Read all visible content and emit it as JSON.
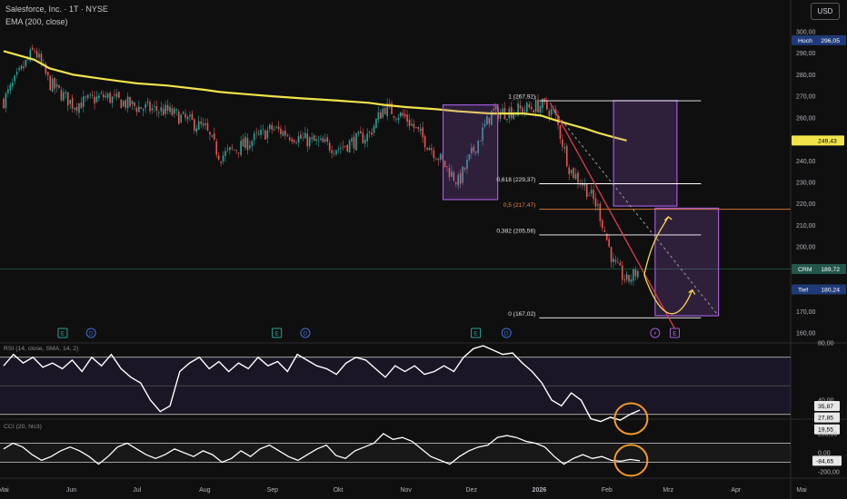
{
  "header": {
    "symbol_line": "Salesforce, Inc. · 1T · NYSE",
    "ema_line": "EMA (200, close)",
    "currency_button": "USD"
  },
  "colors": {
    "up": "#26a69a",
    "down": "#ef5350",
    "ema": "#f2e34b",
    "box": "#a15ad8",
    "fib": "#ffffff",
    "fib_mid": "#e8833a",
    "trend_red": "#e03a4c",
    "sketch": "#f5d84a",
    "ring": "#f39c22"
  },
  "chart_data": [
    {
      "type": "candlestick",
      "ylim": [
        155,
        302
      ],
      "y_ticks": [
        "300,00",
        "290,00",
        "280,00",
        "270,00",
        "260,00",
        "250,00",
        "240,00",
        "230,00",
        "220,00",
        "210,00",
        "200,00",
        "190,00",
        "170,00",
        "160,00"
      ],
      "x_ticks": [
        "Mai",
        "Jun",
        "Jul",
        "Aug",
        "Sep",
        "Okt",
        "Nov",
        "Dez",
        "2026",
        "Feb",
        "Mrz",
        "Apr",
        "Mai"
      ],
      "x": [
        "2025-05-01",
        "2025-05-15",
        "2025-05-22",
        "2025-06-02",
        "2025-06-16",
        "2025-07-01",
        "2025-07-15",
        "2025-08-01",
        "2025-08-08",
        "2025-08-20",
        "2025-09-01",
        "2025-09-15",
        "2025-10-01",
        "2025-10-15",
        "2025-10-22",
        "2025-11-01",
        "2025-11-15",
        "2025-11-25",
        "2025-12-10",
        "2025-12-25",
        "2026-01-02",
        "2026-01-08",
        "2026-01-15",
        "2026-01-22",
        "2026-01-28",
        "2026-02-04",
        "2026-02-10",
        "2026-02-16"
      ],
      "close": [
        268,
        292,
        276,
        266,
        270,
        265,
        263,
        255,
        242,
        248,
        255,
        250,
        246,
        252,
        265,
        260,
        243,
        230,
        262,
        264,
        266,
        262,
        236,
        228,
        218,
        192,
        184,
        189.72
      ],
      "ema_200": [
        291,
        287,
        283,
        280,
        278,
        276,
        275,
        273,
        272,
        271,
        270,
        269,
        268,
        267,
        266,
        265,
        264,
        263,
        262,
        262,
        261,
        259,
        257,
        255,
        253,
        251,
        249.43
      ],
      "price_labels": [
        {
          "label": "Hoch",
          "value": "296,05",
          "v": 296.05
        },
        {
          "label": "",
          "value": "249,43",
          "v": 249.43
        },
        {
          "label": "CRM",
          "value": "189,72",
          "v": 189.72
        },
        {
          "label": "Tief",
          "value": "180,24",
          "v": 180.24
        }
      ],
      "fib_levels": [
        {
          "label": "1 (267,92)",
          "v": 267.92
        },
        {
          "label": "0,618 (229,37)",
          "v": 229.37
        },
        {
          "label": "0,5 (217,47)",
          "v": 217.47
        },
        {
          "label": "0,382 (205,56)",
          "v": 205.56
        },
        {
          "label": "0 (167,02)",
          "v": 167.02
        }
      ],
      "event_markers": [
        {
          "x": "2025-05-28",
          "text": "E"
        },
        {
          "x": "2025-06-10",
          "text": "D"
        },
        {
          "x": "2025-09-03",
          "text": "E"
        },
        {
          "x": "2025-09-16",
          "text": "D"
        },
        {
          "x": "2025-12-03",
          "text": "E"
        },
        {
          "x": "2025-12-17",
          "text": "D"
        },
        {
          "x": "2026-02-23",
          "text": "⚡"
        },
        {
          "x": "2026-03-04",
          "text": "E"
        }
      ]
    },
    {
      "type": "line",
      "title": "RSI (14, close, SMA, 14, 2)",
      "ylim": [
        15,
        85
      ],
      "y_ticks": [
        "80,00",
        "40,00"
      ],
      "bands": [
        70,
        50,
        30
      ],
      "values": [
        64,
        72,
        66,
        70,
        63,
        66,
        62,
        68,
        60,
        70,
        64,
        72,
        62,
        56,
        52,
        40,
        32,
        36,
        60,
        66,
        70,
        62,
        67,
        60,
        66,
        62,
        70,
        64,
        67,
        60,
        72,
        68,
        64,
        62,
        58,
        66,
        70,
        68,
        62,
        56,
        64,
        60,
        64,
        58,
        60,
        64,
        60,
        70,
        76,
        78,
        75,
        72,
        73,
        66,
        60,
        52,
        40,
        36,
        45,
        40,
        27,
        25,
        28,
        26,
        30,
        33
      ],
      "price_labels": [
        {
          "value": "35,87",
          "v": 35.87
        },
        {
          "value": "27,85",
          "v": 27.85
        },
        {
          "value": "19,55",
          "v": 19.55
        }
      ]
    },
    {
      "type": "line",
      "title": "CCI (20, hlc3)",
      "ylim": [
        -250,
        280
      ],
      "y_ticks": [
        "200,00",
        "0,00",
        "-200,00"
      ],
      "bands": [
        100,
        -100
      ],
      "values": [
        40,
        100,
        60,
        -20,
        -80,
        -40,
        20,
        60,
        20,
        -40,
        -120,
        -40,
        60,
        100,
        40,
        -20,
        -60,
        -20,
        40,
        0,
        -40,
        20,
        -20,
        -100,
        -60,
        20,
        -40,
        40,
        80,
        20,
        -40,
        -80,
        -20,
        40,
        80,
        -30,
        -60,
        20,
        60,
        100,
        200,
        140,
        160,
        120,
        40,
        -40,
        -80,
        -120,
        -40,
        20,
        60,
        80,
        160,
        180,
        160,
        120,
        100,
        60,
        -40,
        -120,
        -60,
        -20,
        -60,
        -40,
        -80,
        -90,
        -70,
        -84.65
      ],
      "price_labels": [
        {
          "value": "-84,65",
          "v": -84.65
        }
      ]
    }
  ]
}
